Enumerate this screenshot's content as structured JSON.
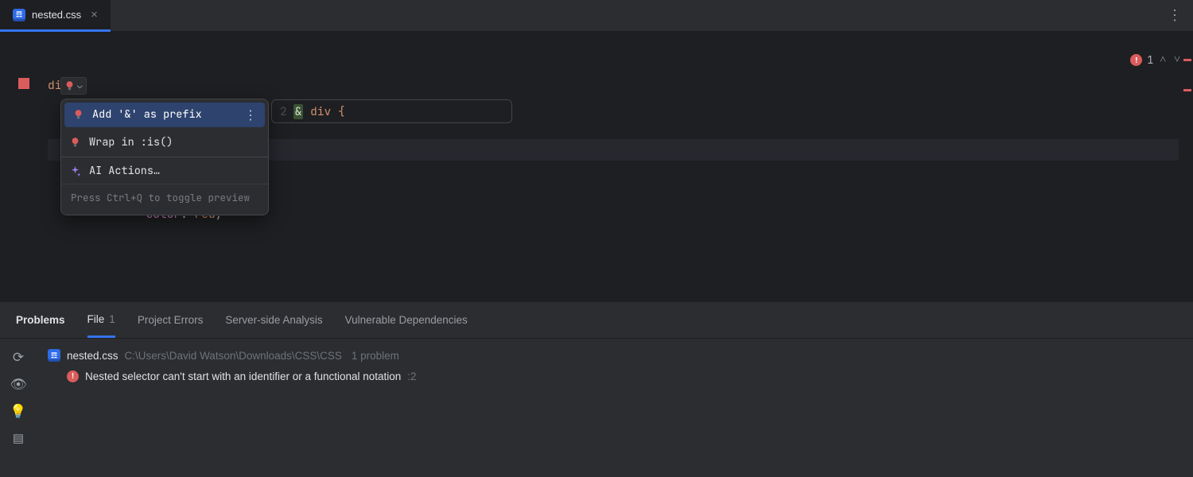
{
  "tab": {
    "filename": "nested.css"
  },
  "code": {
    "l1_sel": "div",
    "l1_brace": " {",
    "l2_indent": "    ",
    "l2_sel": "div",
    "l2_brace": " {",
    "l3_indent": "        ",
    "l3_prop": "color",
    "l3_colon": ": ",
    "l3_val": "red",
    "l3_semi": ";"
  },
  "annotations": {
    "error_count": "1"
  },
  "quickfix": {
    "item1": "Add '&' as prefix",
    "item2": "Wrap in :is()",
    "item3": "AI Actions…",
    "hint": "Press Ctrl+Q to toggle preview"
  },
  "preview": {
    "line_no": "2",
    "amp": "&",
    "rest": " div {"
  },
  "bottom": {
    "tab_problems": "Problems",
    "tab_file": "File",
    "tab_file_count": "1",
    "tab_project": "Project Errors",
    "tab_server": "Server-side Analysis",
    "tab_vuln": "Vulnerable Dependencies",
    "file_name": "nested.css",
    "file_path": "C:\\Users\\David Watson\\Downloads\\CSS\\CSS",
    "file_problem_count": "1 problem",
    "issue_text": "Nested selector can't start with an identifier or a functional notation",
    "issue_line": ":2"
  }
}
